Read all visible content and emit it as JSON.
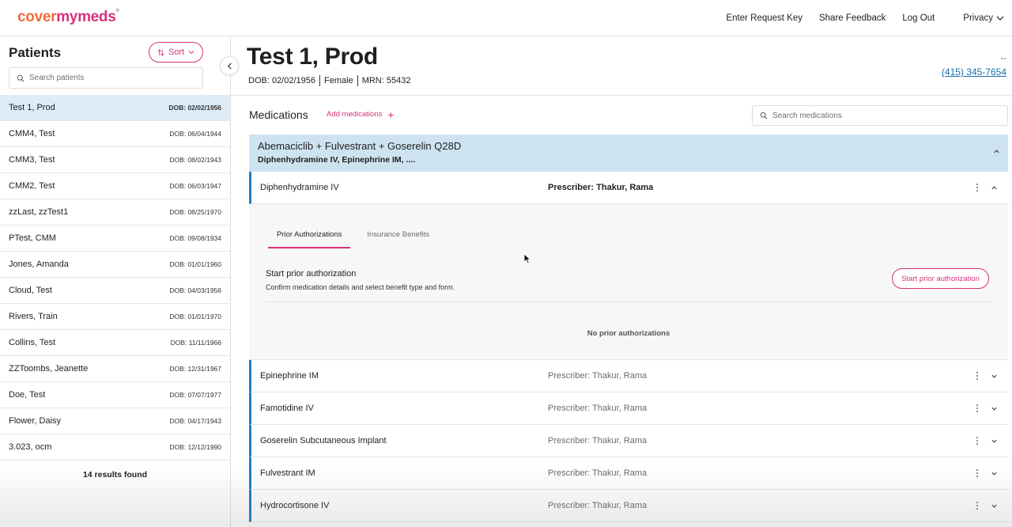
{
  "brand": {
    "logo_part1": "cover",
    "logo_part2": "mymeds",
    "logo_mark": "®"
  },
  "topnav": {
    "enter_request_key": "Enter Request Key",
    "share_feedback": "Share Feedback",
    "log_out": "Log Out",
    "privacy": "Privacy"
  },
  "sidebar": {
    "title": "Patients",
    "sort_label": "Sort",
    "search_placeholder": "Search patients",
    "patients": [
      {
        "name": "Test 1, Prod",
        "dob": "DOB: 02/02/1956"
      },
      {
        "name": "CMM4, Test",
        "dob": "DOB: 06/04/1944"
      },
      {
        "name": "CMM3, Test",
        "dob": "DOB: 08/02/1943"
      },
      {
        "name": "CMM2, Test",
        "dob": "DOB: 06/03/1947"
      },
      {
        "name": "zzLast, zzTest1",
        "dob": "DOB: 08/25/1970"
      },
      {
        "name": "PTest, CMM",
        "dob": "DOB: 09/08/1934"
      },
      {
        "name": "Jones, Amanda",
        "dob": "DOB: 01/01/1960"
      },
      {
        "name": "Cloud, Test",
        "dob": "DOB: 04/03/1956"
      },
      {
        "name": "Rivers, Train",
        "dob": "DOB: 01/01/1970"
      },
      {
        "name": "Collins, Test",
        "dob": "DOB: 11/11/1966"
      },
      {
        "name": "ZZToombs, Jeanette",
        "dob": "DOB: 12/31/1967"
      },
      {
        "name": "Doe, Test",
        "dob": "DOB: 07/07/1977"
      },
      {
        "name": "Flower, Daisy",
        "dob": "DOB: 04/17/1943"
      },
      {
        "name": "3.023, ocm",
        "dob": "DOB: 12/12/1990"
      }
    ],
    "results": "14 results found"
  },
  "patient": {
    "name": "Test 1, Prod",
    "dob": "DOB: 02/02/1956",
    "sex": "Female",
    "mrn": "MRN: 55432",
    "dash": "--",
    "phone": "(415) 345-7654"
  },
  "medications": {
    "title": "Medications",
    "add_label": "Add medications",
    "add_icon": "+",
    "search_placeholder": "Search medications",
    "regimen": {
      "title": "Abemaciclib + Fulvestrant + Goserelin Q28D",
      "subtitle": "Diphenhydramine IV, Epinephrine IM, ...."
    },
    "open_med": {
      "name": "Diphenhydramine IV",
      "prescriber": "Prescriber: Thakur, Rama"
    },
    "tabs": {
      "prior_auth": "Prior Authorizations",
      "insurance": "Insurance Benefits"
    },
    "start_pa": {
      "title": "Start prior authorization",
      "subtitle": "Confirm medication details and select benefit type and form.",
      "button": "Start prior authorization"
    },
    "no_pa": "No prior authorizations",
    "list": [
      {
        "name": "Epinephrine IM",
        "prescriber": "Prescriber: Thakur, Rama"
      },
      {
        "name": "Famotidine IV",
        "prescriber": "Prescriber: Thakur, Rama"
      },
      {
        "name": "Goserelin Subcutaneous Implant",
        "prescriber": "Prescriber: Thakur, Rama"
      },
      {
        "name": "Fulvestrant IM",
        "prescriber": "Prescriber: Thakur, Rama"
      },
      {
        "name": "Hydrocortisone IV",
        "prescriber": "Prescriber: Thakur, Rama"
      }
    ]
  },
  "colors": {
    "accent": "#d6327a",
    "brand_orange": "#f26b3a",
    "selected_row": "#dcecf8",
    "regimen_bg": "#cde3f0",
    "med_border": "#1a7fc0",
    "link": "#1a6fa8"
  },
  "icons": [
    "chevron-down-icon",
    "sort-icon",
    "search-icon",
    "chevron-left-icon",
    "chevron-up-icon",
    "kebab-icon",
    "cursor-icon"
  ]
}
